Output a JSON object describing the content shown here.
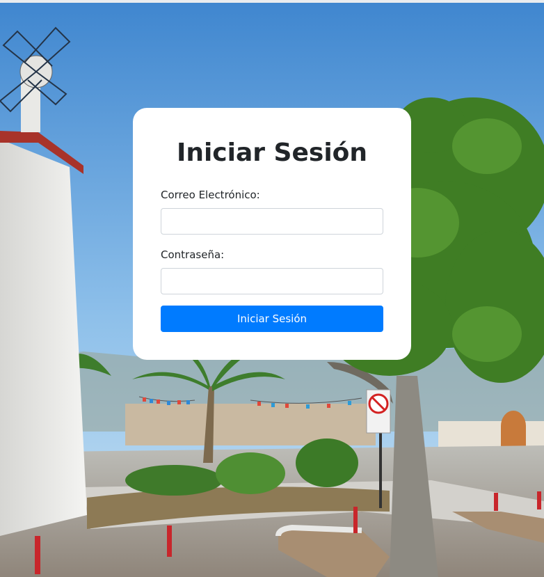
{
  "login": {
    "title": "Iniciar Sesión",
    "email_label": "Correo Electrónico:",
    "email_value": "",
    "password_label": "Contraseña:",
    "password_value": "",
    "submit_label": "Iniciar Sesión"
  },
  "colors": {
    "primary": "#007bff",
    "card_bg": "#ffffff",
    "text": "#212529",
    "input_border": "#ced4da"
  }
}
